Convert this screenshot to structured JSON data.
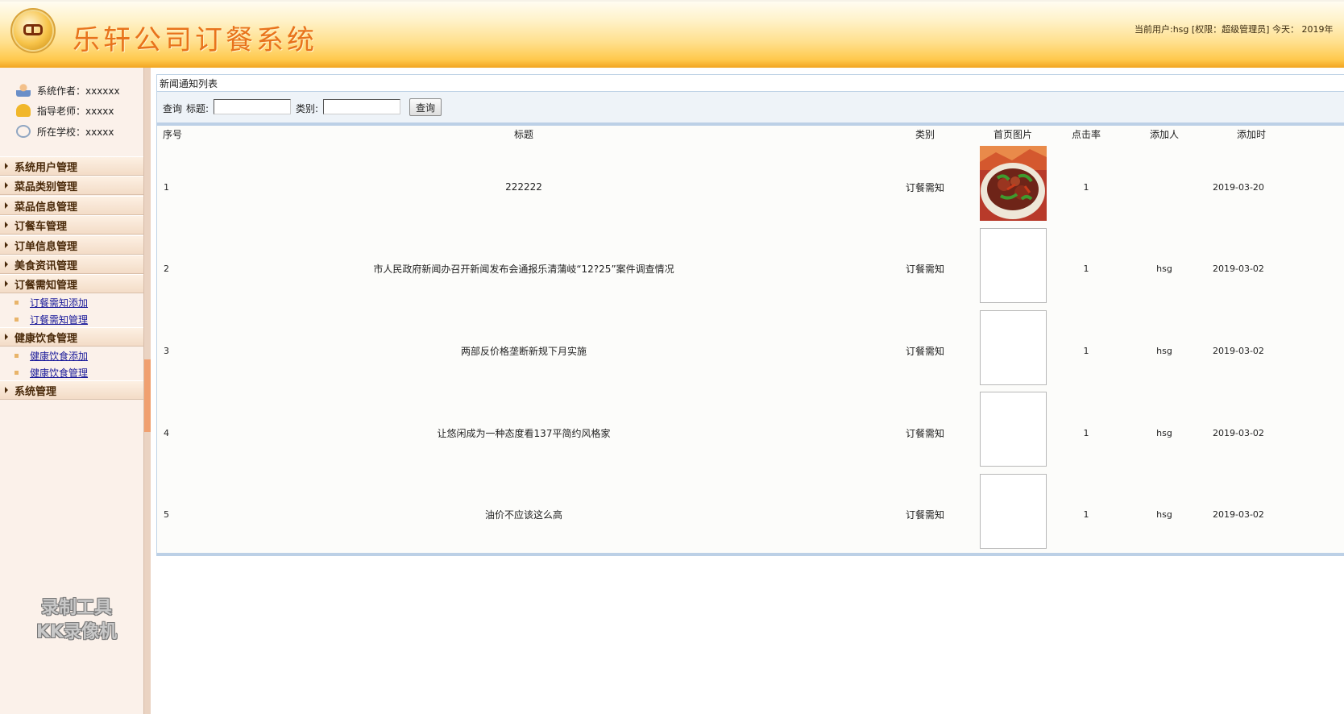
{
  "header": {
    "app_title": "乐轩公司订餐系统",
    "user_info": "当前用户:hsg [权限：超级管理员] 今天： 2019年"
  },
  "sidebar": {
    "info": [
      {
        "label": "系统作者：xxxxxx",
        "icon": "author-icon"
      },
      {
        "label": "指导老师：xxxxx",
        "icon": "teacher-icon"
      },
      {
        "label": "所在学校：xxxxx",
        "icon": "school-icon"
      }
    ],
    "menus": [
      {
        "label": "系统用户管理"
      },
      {
        "label": "菜品类别管理"
      },
      {
        "label": "菜品信息管理"
      },
      {
        "label": "订餐车管理"
      },
      {
        "label": "订单信息管理"
      },
      {
        "label": "美食资讯管理"
      },
      {
        "label": "订餐需知管理",
        "subs": [
          "订餐需知添加",
          "订餐需知管理"
        ]
      },
      {
        "label": "健康饮食管理",
        "subs": [
          "健康饮食添加",
          "健康饮食管理"
        ]
      },
      {
        "label": "系统管理"
      }
    ],
    "watermark": [
      "录制工具",
      "KK录像机"
    ]
  },
  "main": {
    "list_title": "新闻通知列表",
    "search": {
      "query_label": "查询",
      "title_label": "标题:",
      "title_value": "",
      "category_label": "类别:",
      "category_value": "",
      "button_label": "查询"
    },
    "table": {
      "headers": [
        "序号",
        "标题",
        "类别",
        "首页图片",
        "点击率",
        "添加人",
        "添加时"
      ],
      "rows": [
        {
          "no": "1",
          "title": "222222",
          "category": "订餐需知",
          "image": "food-photo",
          "clicks": "1",
          "adder": "",
          "date": "2019-03-20"
        },
        {
          "no": "2",
          "title": "市人民政府新闻办召开新闻发布会通报乐清蒲岐“12?25”案件调查情况",
          "category": "订餐需知",
          "image": "blank",
          "clicks": "1",
          "adder": "hsg",
          "date": "2019-03-02"
        },
        {
          "no": "3",
          "title": "两部反价格垄断新规下月实施",
          "category": "订餐需知",
          "image": "blank",
          "clicks": "1",
          "adder": "hsg",
          "date": "2019-03-02"
        },
        {
          "no": "4",
          "title": "让悠闲成为一种态度看137平简约风格家",
          "category": "订餐需知",
          "image": "blank",
          "clicks": "1",
          "adder": "hsg",
          "date": "2019-03-02"
        },
        {
          "no": "5",
          "title": "油价不应该这么高",
          "category": "订餐需知",
          "image": "blank",
          "clicks": "1",
          "adder": "hsg",
          "date": "2019-03-02"
        }
      ]
    }
  },
  "colors": {
    "header_orange": "#ffc94d",
    "title_orange": "#e8731c",
    "sidebar_bg": "#fbf1ea",
    "table_border": "#bcd0e6",
    "link_blue": "#1a1a9a"
  }
}
